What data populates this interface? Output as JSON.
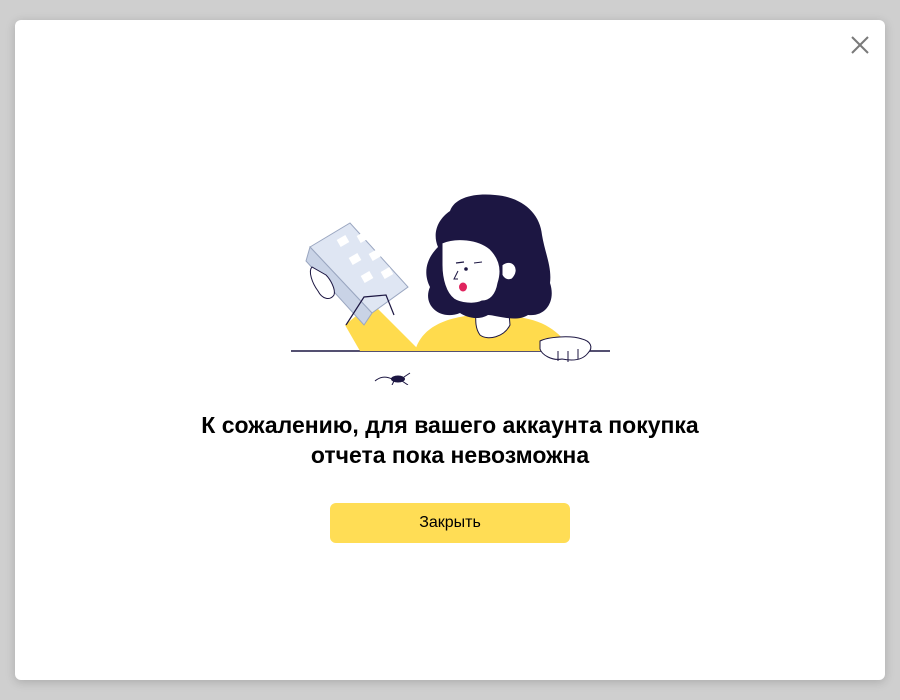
{
  "dialog": {
    "close_icon": "close-icon",
    "illustration": "woman-with-building-illustration",
    "message_line1": "К сожалению, для вашего аккаунта покупка",
    "message_line2": "отчета пока невозможна",
    "close_button_label": "Закрыть"
  },
  "colors": {
    "accent": "#ffdd55",
    "hair": "#1c1642",
    "sweater": "#ffdb4d",
    "building": "#dfe6f3"
  }
}
